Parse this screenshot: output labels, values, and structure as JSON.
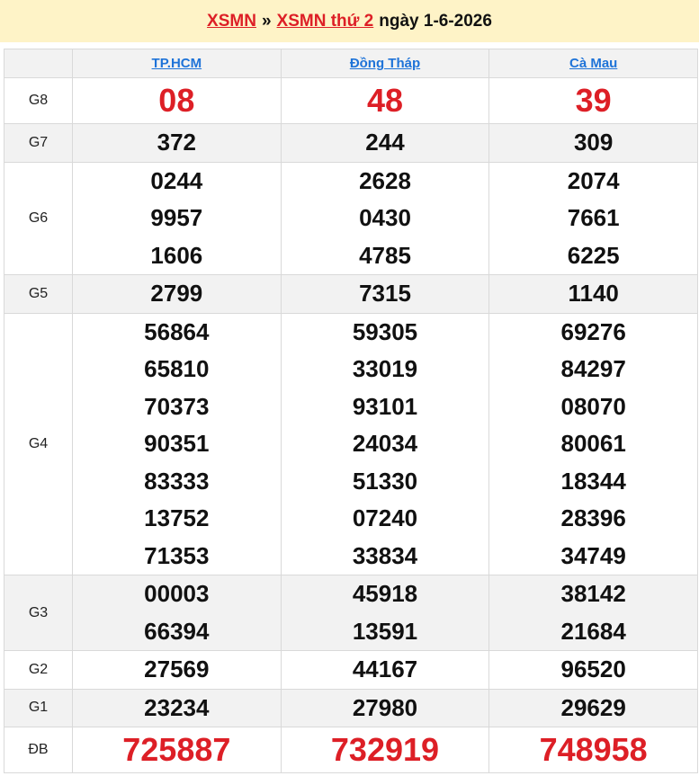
{
  "header": {
    "link1": "XSMN",
    "sep": "»",
    "link2": "XSMN thứ 2",
    "date": "ngày 1-6-2026"
  },
  "provinces": [
    "TP.HCM",
    "Đồng Tháp",
    "Cà Mau"
  ],
  "prizes": [
    {
      "label": "G8",
      "style": "big",
      "values": [
        [
          "08"
        ],
        [
          "48"
        ],
        [
          "39"
        ]
      ]
    },
    {
      "label": "G7",
      "style": "num",
      "values": [
        [
          "372"
        ],
        [
          "244"
        ],
        [
          "309"
        ]
      ]
    },
    {
      "label": "G6",
      "style": "num",
      "values": [
        [
          "0244",
          "9957",
          "1606"
        ],
        [
          "2628",
          "0430",
          "4785"
        ],
        [
          "2074",
          "7661",
          "6225"
        ]
      ]
    },
    {
      "label": "G5",
      "style": "num",
      "values": [
        [
          "2799"
        ],
        [
          "7315"
        ],
        [
          "1140"
        ]
      ]
    },
    {
      "label": "G4",
      "style": "num",
      "values": [
        [
          "56864",
          "65810",
          "70373",
          "90351",
          "83333",
          "13752",
          "71353"
        ],
        [
          "59305",
          "33019",
          "93101",
          "24034",
          "51330",
          "07240",
          "33834"
        ],
        [
          "69276",
          "84297",
          "08070",
          "80061",
          "18344",
          "28396",
          "34749"
        ]
      ]
    },
    {
      "label": "G3",
      "style": "num",
      "values": [
        [
          "00003",
          "66394"
        ],
        [
          "45918",
          "13591"
        ],
        [
          "38142",
          "21684"
        ]
      ]
    },
    {
      "label": "G2",
      "style": "num",
      "values": [
        [
          "27569"
        ],
        [
          "44167"
        ],
        [
          "96520"
        ]
      ]
    },
    {
      "label": "G1",
      "style": "num",
      "values": [
        [
          "23234"
        ],
        [
          "27980"
        ],
        [
          "29629"
        ]
      ]
    },
    {
      "label": "ĐB",
      "style": "big",
      "values": [
        [
          "725887"
        ],
        [
          "732919"
        ],
        [
          "748958"
        ]
      ]
    }
  ]
}
